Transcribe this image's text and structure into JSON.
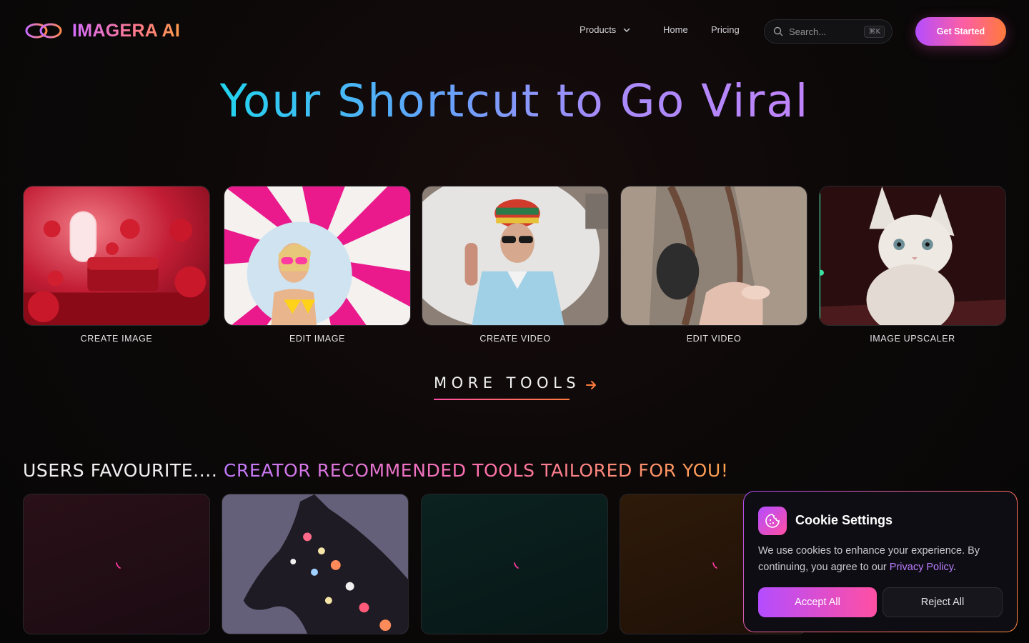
{
  "brand": {
    "name": "IMAGERA AI"
  },
  "nav": {
    "products_label": "Products",
    "home_label": "Home",
    "pricing_label": "Pricing"
  },
  "search": {
    "placeholder": "Search...",
    "shortcut": "⌘K"
  },
  "cta": {
    "get_started_label": "Get Started"
  },
  "hero": {
    "title": "Your Shortcut to Go Viral"
  },
  "tools": [
    {
      "label": "CREATE IMAGE"
    },
    {
      "label": "EDIT IMAGE"
    },
    {
      "label": "CREATE VIDEO"
    },
    {
      "label": "EDIT VIDEO"
    },
    {
      "label": "IMAGE UPSCALER"
    }
  ],
  "more_tools": {
    "label": "MORE TOOLS"
  },
  "favourites": {
    "heading_white": "USERS FAVOURITE....",
    "heading_gradient": "CREATOR RECOMMENDED TOOLS TAILORED FOR YOU!"
  },
  "cookie": {
    "title": "Cookie Settings",
    "text": "We use cookies to enhance your experience. By continuing, you agree to our",
    "link": "Privacy Policy",
    "period": ".",
    "accept_label": "Accept All",
    "reject_label": "Reject All"
  },
  "colors": {
    "accent_purple": "#b44dff",
    "accent_pink": "#ff4fa3",
    "accent_orange": "#ff7b3b"
  },
  "icons": [
    "logo-mark-icon",
    "chevron-down-icon",
    "search-icon",
    "arrow-right-icon",
    "cookie-icon",
    "loading-spinner-icon"
  ]
}
